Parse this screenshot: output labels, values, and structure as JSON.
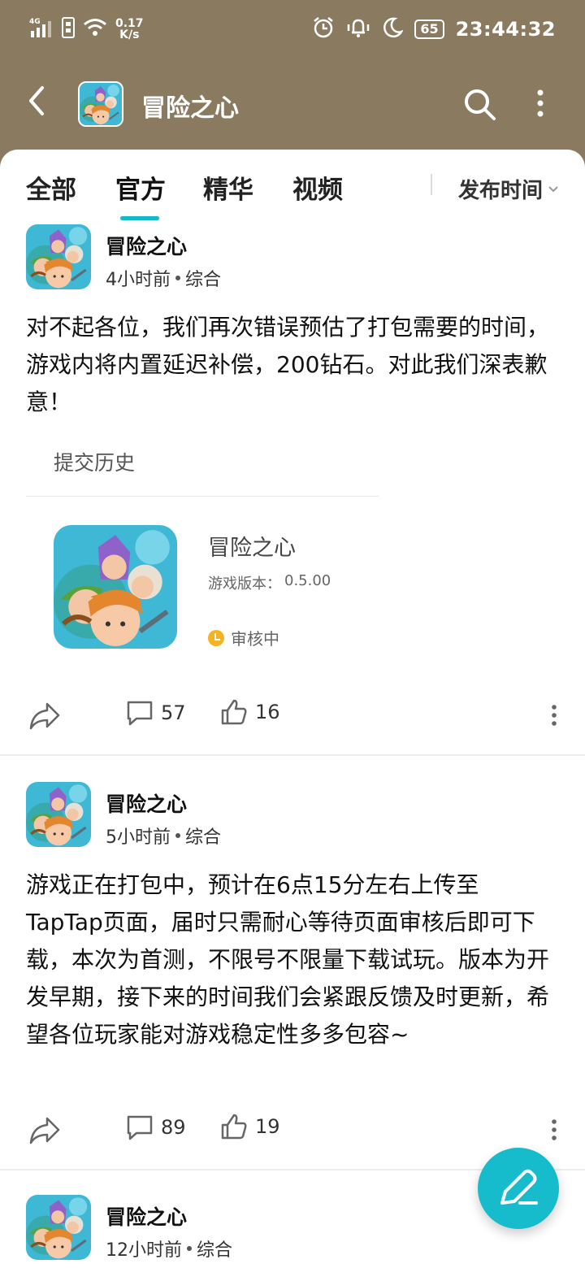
{
  "status_bar": {
    "network": "4G",
    "speed_value": "0.17",
    "speed_unit": "K/s",
    "battery": "65",
    "time": "23:44:32"
  },
  "header": {
    "title": "冒险之心"
  },
  "tabs": {
    "items": [
      {
        "label": "全部"
      },
      {
        "label": "官方"
      },
      {
        "label": "精华"
      },
      {
        "label": "视频"
      }
    ],
    "active": "官方",
    "sort_label": "发布时间"
  },
  "posts": [
    {
      "author": "冒险之心",
      "time": "4小时前",
      "category": "综合",
      "content": "对不起各位，我们再次错误预估了打包需要的时间，游戏内将内置延迟补偿，200钻石。对此我们深表歉意！",
      "history_label": "提交历史",
      "game_card": {
        "name": "冒险之心",
        "version_label": "游戏版本：",
        "version": "0.5.00",
        "status": "审核中"
      },
      "comments": "57",
      "likes": "16"
    },
    {
      "author": "冒险之心",
      "time": "5小时前",
      "category": "综合",
      "content": "游戏正在打包中，预计在6点15分左右上传至TapTap页面，届时只需耐心等待页面审核后即可下载，本次为首测，不限号不限量下载试玩。版本为开发早期，接下来的时间我们会紧跟反馈及时更新，希望各位玩家能对游戏稳定性多多包容~",
      "comments": "89",
      "likes": "19"
    },
    {
      "author": "冒险之心",
      "time": "12小时前",
      "category": "综合"
    }
  ],
  "colors": {
    "header_bg": "#8a7b60",
    "accent": "#14b9c8",
    "status_pending": "#f5b322"
  }
}
